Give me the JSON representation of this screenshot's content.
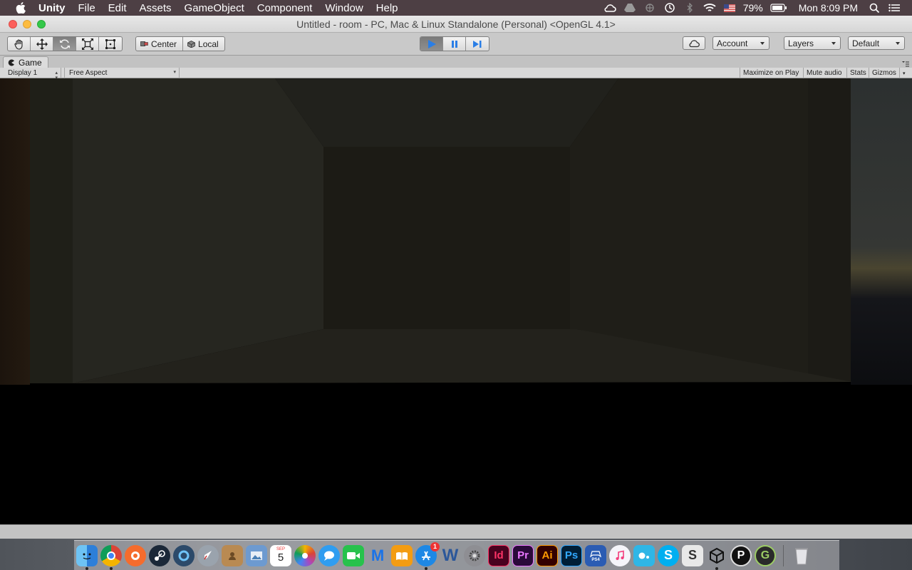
{
  "menubar": {
    "items": [
      "Unity",
      "File",
      "Edit",
      "Assets",
      "GameObject",
      "Component",
      "Window",
      "Help"
    ],
    "battery": "79%",
    "clock": "Mon 8:09 PM",
    "status_icons": [
      "creative-cloud-icon",
      "google-drive-icon",
      "sync-icon",
      "time-machine-icon",
      "bluetooth-icon",
      "wifi-icon",
      "us-flag-icon",
      "battery-icon"
    ]
  },
  "window": {
    "title": "Untitled - room - PC, Mac & Linux Standalone (Personal) <OpenGL 4.1>"
  },
  "toolbar": {
    "transform_tools": [
      "hand-tool",
      "move-tool",
      "rotate-tool",
      "scale-tool",
      "rect-tool"
    ],
    "active_tool": "rotate-tool",
    "pivot_label": "Center",
    "space_label": "Local",
    "play_state": "playing",
    "account_label": "Account",
    "layers_label": "Layers",
    "layout_label": "Default"
  },
  "game_panel": {
    "tab_label": "Game",
    "display_label": "Display 1",
    "aspect_label": "Free Aspect",
    "maximize_label": "Maximize on Play",
    "mute_label": "Mute audio",
    "stats_label": "Stats",
    "gizmos_label": "Gizmos"
  },
  "dock": {
    "calendar_month": "SEP",
    "calendar_day": "5",
    "appstore_badge": "1",
    "apps": [
      {
        "name": "Finder",
        "label": "",
        "color": "#3a8ee6"
      },
      {
        "name": "Chrome",
        "label": "",
        "color": "#e8e8e8"
      },
      {
        "name": "Origin",
        "label": "",
        "color": "#f56c2d"
      },
      {
        "name": "Steam",
        "label": "",
        "color": "#1b2838"
      },
      {
        "name": "Malwarebytes",
        "label": "",
        "color": "#1f3b57"
      },
      {
        "name": "Launchpad",
        "label": "",
        "color": "#7c8692"
      },
      {
        "name": "Contacts",
        "label": "",
        "color": "#b98a52"
      },
      {
        "name": "Preview",
        "label": "",
        "color": "#4a7fb5"
      },
      {
        "name": "Photos",
        "label": "",
        "color": "#f2f2f2"
      },
      {
        "name": "Messages",
        "label": "",
        "color": "#2f9df0"
      },
      {
        "name": "FaceTime",
        "label": "",
        "color": "#27c24c"
      },
      {
        "name": "Malwarebytes-M",
        "label": "M",
        "color": "#1a73e8"
      },
      {
        "name": "iBooks",
        "label": "",
        "color": "#f39c12"
      },
      {
        "name": "App Store",
        "label": "",
        "color": "#1e88e5"
      },
      {
        "name": "Word",
        "label": "W",
        "color": "#2b579a"
      },
      {
        "name": "System Preferences",
        "label": "",
        "color": "#8e8e93"
      },
      {
        "name": "InDesign",
        "label": "Id",
        "color": "#49021f"
      },
      {
        "name": "Premiere",
        "label": "Pr",
        "color": "#2a0a3a"
      },
      {
        "name": "Illustrator",
        "label": "Ai",
        "color": "#330000"
      },
      {
        "name": "Photoshop",
        "label": "Ps",
        "color": "#001e36"
      },
      {
        "name": "PS4 Remote Play",
        "label": "PS4",
        "color": "#2b5cb3"
      },
      {
        "name": "iTunes",
        "label": "",
        "color": "#f0f0f5"
      },
      {
        "name": "Screen",
        "label": "",
        "color": "#2fb6e6"
      },
      {
        "name": "Skype",
        "label": "S",
        "color": "#00aff0"
      },
      {
        "name": "Scrivener",
        "label": "S",
        "color": "#e8e8e8"
      },
      {
        "name": "Unity",
        "label": "",
        "color": "#222222"
      },
      {
        "name": "Pixelmator",
        "label": "P",
        "color": "#111111"
      },
      {
        "name": "Grammarly",
        "label": "G",
        "color": "#2a2a2a"
      },
      {
        "name": "Trash",
        "label": "",
        "color": "#d9d9dc"
      }
    ]
  }
}
